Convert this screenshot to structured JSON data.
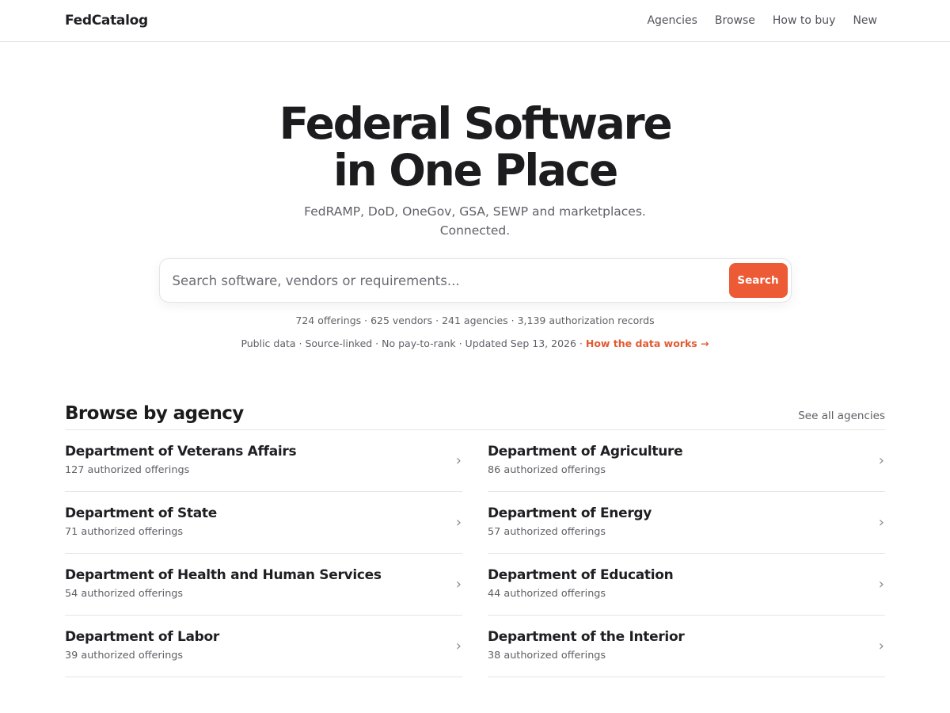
{
  "header": {
    "brand": "FedCatalog",
    "nav": [
      "Agencies",
      "Browse",
      "How to buy",
      "New"
    ]
  },
  "hero": {
    "title_line1": "Federal Software",
    "title_line2": "in One Place",
    "subtitle_line1": "FedRAMP, DoD, OneGov, GSA, SEWP and marketplaces.",
    "subtitle_line2": "Connected.",
    "search_placeholder": "Search software, vendors or requirements...",
    "search_button": "Search",
    "stats": "724 offerings · 625 vendors · 241 agencies · 3,139 authorization records",
    "meta": "Public data · Source-linked · No pay-to-rank · Updated Sep 13, 2026 · ",
    "meta_link": "How the data works →"
  },
  "agencies_section": {
    "title": "Browse by agency",
    "see_all": "See all agencies",
    "chevron": "›",
    "items": [
      {
        "name": "Department of Veterans Affairs",
        "count": "127 authorized offerings"
      },
      {
        "name": "Department of Agriculture",
        "count": "86 authorized offerings"
      },
      {
        "name": "Department of State",
        "count": "71 authorized offerings"
      },
      {
        "name": "Department of Energy",
        "count": "57 authorized offerings"
      },
      {
        "name": "Department of Health and Human Services",
        "count": "54 authorized offerings"
      },
      {
        "name": "Department of Education",
        "count": "44 authorized offerings"
      },
      {
        "name": "Department of Labor",
        "count": "39 authorized offerings"
      },
      {
        "name": "Department of the Interior",
        "count": "38 authorized offerings"
      }
    ]
  },
  "colors": {
    "accent": "#ed5a36",
    "link_accent": "#e35a33"
  }
}
